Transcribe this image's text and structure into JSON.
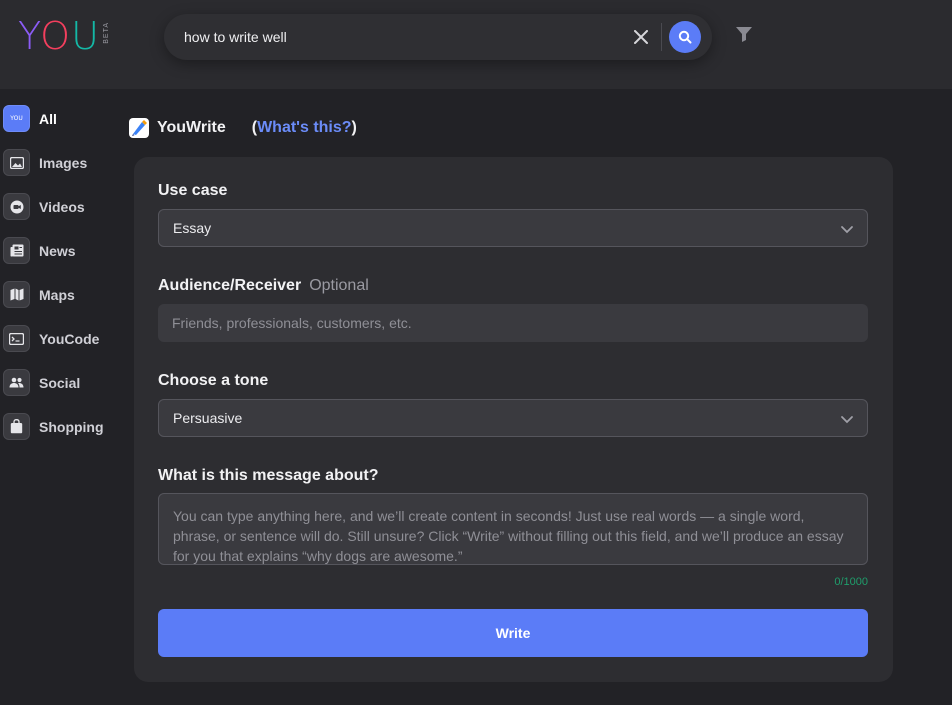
{
  "brand": {
    "logo_text_y": "Y",
    "logo_text_o": "O",
    "logo_text_u": "U",
    "beta_label": "BETA"
  },
  "search": {
    "query": "how to write well",
    "clear_icon": "close-icon",
    "search_icon": "search-icon",
    "filter_icon": "filter-icon"
  },
  "sidebar": {
    "items": [
      {
        "label": "All",
        "icon": "you-icon",
        "active": true,
        "icon_text": "YOU"
      },
      {
        "label": "Images",
        "icon": "image-icon"
      },
      {
        "label": "Videos",
        "icon": "video-icon"
      },
      {
        "label": "News",
        "icon": "news-icon"
      },
      {
        "label": "Maps",
        "icon": "map-icon"
      },
      {
        "label": "YouCode",
        "icon": "code-icon"
      },
      {
        "label": "Social",
        "icon": "people-icon"
      },
      {
        "label": "Shopping",
        "icon": "shopping-bag-icon"
      }
    ]
  },
  "youwrite": {
    "title": "YouWrite",
    "whats_open": "(",
    "whats_link": "What's this?",
    "whats_close": ")"
  },
  "form": {
    "use_case_label": "Use case",
    "use_case_value": "Essay",
    "audience_label": "Audience/Receiver",
    "audience_optional": "Optional",
    "audience_placeholder": "Friends, professionals, customers, etc.",
    "tone_label": "Choose a tone",
    "tone_value": "Persuasive",
    "message_label": "What is this message about?",
    "message_placeholder": "You can type anything here, and we’ll create content in seconds! Just use real words — a single word, phrase, or sentence will do. Still unsure? Click “Write” without filling out this field, and we’ll produce an essay for you that explains “why dogs are awesome.”",
    "counter": "0/1000",
    "write_button": "Write"
  },
  "colors": {
    "accent": "#5b7cf7",
    "link": "#6b8cf8",
    "counter": "#1f9d6b",
    "background": "#222226",
    "card": "#2d2d31"
  }
}
